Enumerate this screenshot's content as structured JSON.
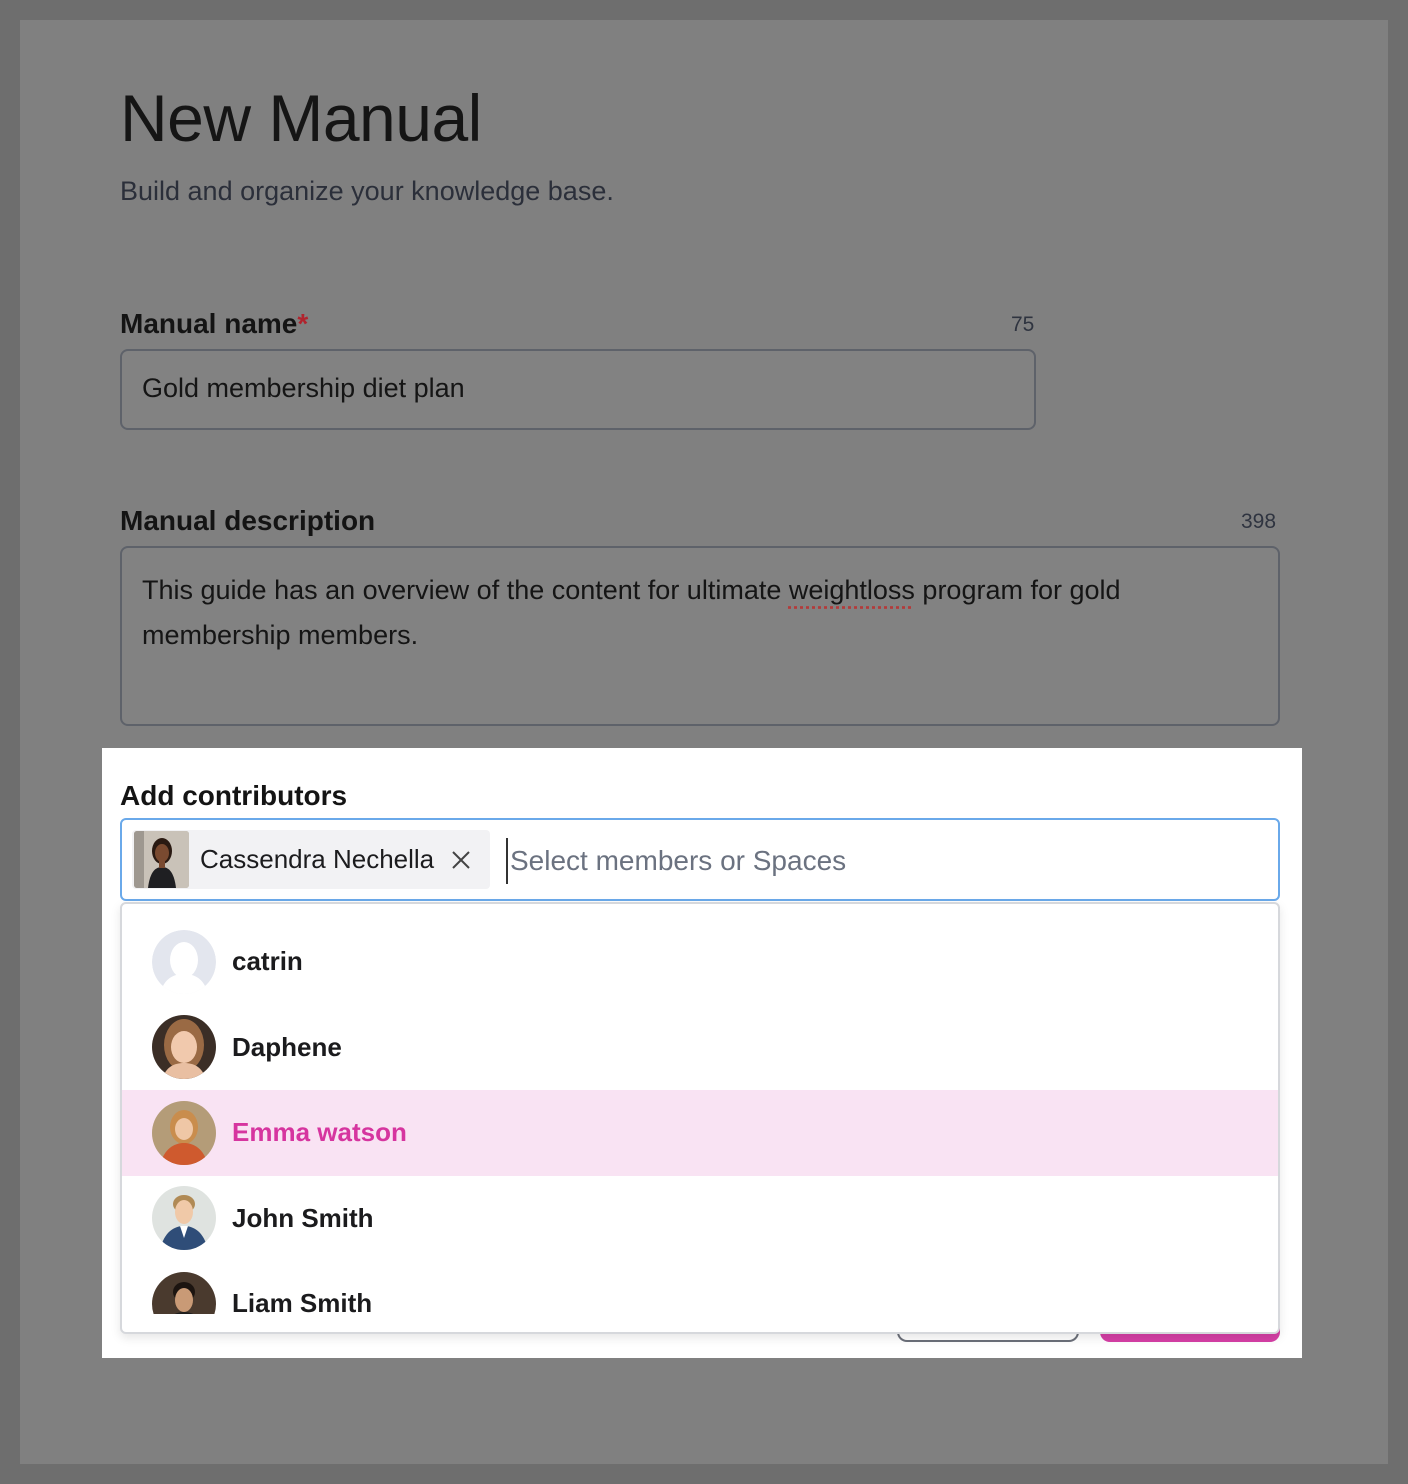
{
  "page": {
    "title": "New Manual",
    "subtitle": "Build and organize your knowledge base."
  },
  "manual_name": {
    "label": "Manual name",
    "required_mark": "*",
    "counter": "75",
    "value": "Gold membership diet plan"
  },
  "manual_description": {
    "label": "Manual description",
    "counter": "398",
    "value_before": "This guide has an overview of the content for ultimate ",
    "value_misspelled": "weightloss",
    "value_after": " program for gold membership members."
  },
  "contributors": {
    "label": "Add contributors",
    "selected": [
      {
        "name": "Cassendra Nechella",
        "avatar": "photo-avatar"
      }
    ],
    "placeholder": "Select members or Spaces",
    "options": [
      {
        "name": "catrin",
        "avatar": "default-avatar-icon"
      },
      {
        "name": "Daphene",
        "avatar": "photo-avatar"
      },
      {
        "name": "Emma watson",
        "avatar": "photo-avatar",
        "highlighted": true
      },
      {
        "name": "John Smith",
        "avatar": "photo-avatar"
      },
      {
        "name": "Liam Smith",
        "avatar": "photo-avatar"
      }
    ]
  },
  "colors": {
    "accent": "#d6359f",
    "highlight_bg": "#f9e3f3",
    "focus_border": "#6aa9ea",
    "overlay": "#808080"
  }
}
